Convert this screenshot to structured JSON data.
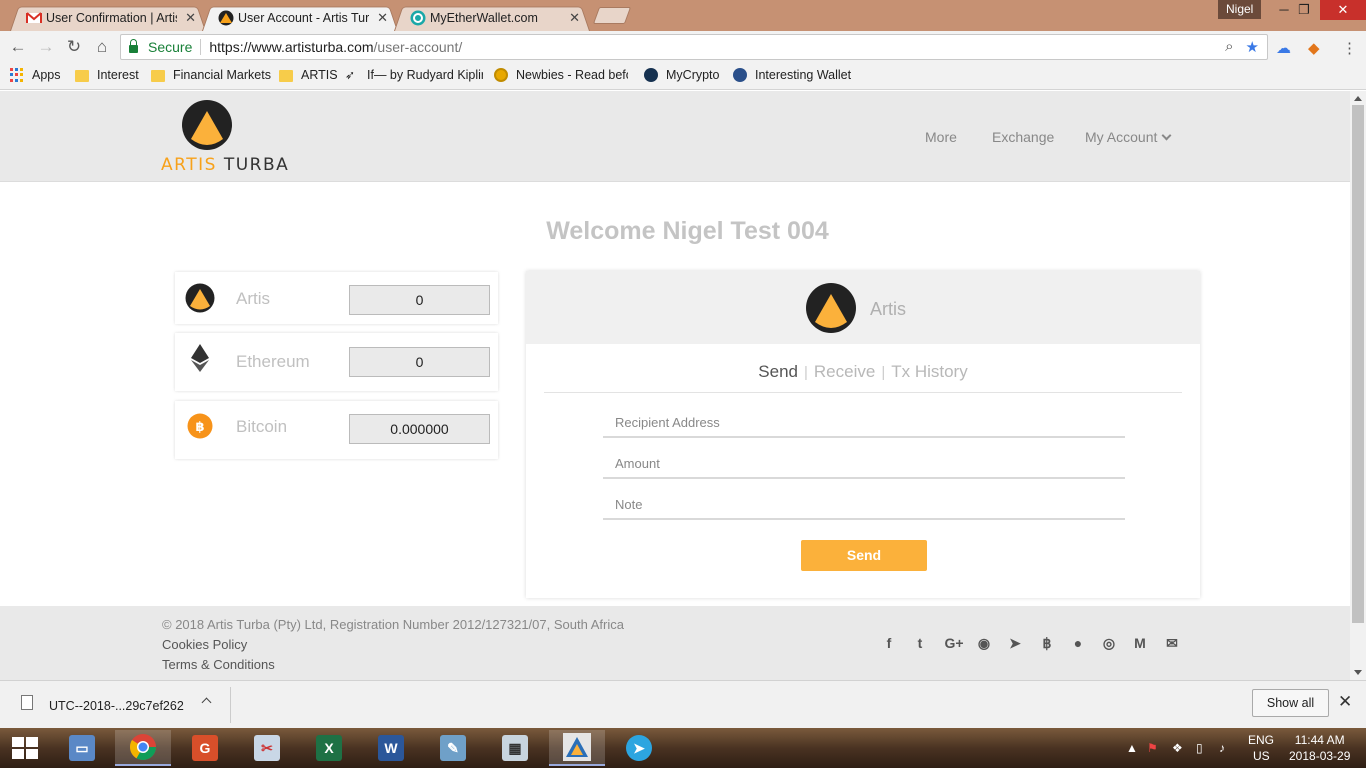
{
  "browser": {
    "tabs": [
      {
        "title": "User Confirmation | Artis",
        "icon": "gmail-icon"
      },
      {
        "title": "User Account - Artis Turb",
        "icon": "artis-icon"
      },
      {
        "title": "MyEtherWallet.com",
        "icon": "myetherwallet-icon"
      }
    ],
    "profile": "Nigel",
    "omnibox": {
      "secure_label": "Secure",
      "url_host": "https://www.artisturba.com",
      "url_path": "/user-account/"
    },
    "bookmarks": [
      {
        "label": "Apps",
        "icon": "apps-grid-icon"
      },
      {
        "label": "Interest",
        "icon": "folder-icon"
      },
      {
        "label": "Financial Markets",
        "icon": "folder-icon"
      },
      {
        "label": "ARTIS",
        "icon": "folder-icon"
      },
      {
        "label": "If— by Rudyard Kiplir",
        "icon": "bird-icon"
      },
      {
        "label": "Newbies - Read befo",
        "icon": "bitcoin-coin-icon"
      },
      {
        "label": "MyCrypto",
        "icon": "mycrypto-icon"
      },
      {
        "label": "Interesting Wallet",
        "icon": "globe-icon"
      }
    ]
  },
  "site": {
    "brand": {
      "part1": "ARTIS",
      "part2": "TURBA"
    },
    "nav": {
      "more": "More",
      "exchange": "Exchange",
      "my_account": "My Account"
    },
    "welcome": "Welcome Nigel Test 004",
    "balances": [
      {
        "name": "Artis",
        "value": "0",
        "icon": "artis-icon"
      },
      {
        "name": "Ethereum",
        "value": "0",
        "icon": "ethereum-icon"
      },
      {
        "name": "Bitcoin",
        "value": "0.000000",
        "icon": "bitcoin-icon"
      }
    ],
    "panel": {
      "title": "Artis",
      "tabs": {
        "send": "Send",
        "receive": "Receive",
        "history": "Tx History"
      },
      "fields": {
        "recipient": "Recipient Address",
        "amount": "Amount",
        "note": "Note"
      },
      "send_button": "Send"
    },
    "footer": {
      "copyright": "© 2018 Artis Turba (Pty) Ltd, Registration Number 2012/127321/07, South Africa",
      "cookies": "Cookies Policy",
      "terms": "Terms & Conditions",
      "social": [
        {
          "name": "facebook-icon",
          "glyph": "f"
        },
        {
          "name": "twitter-icon",
          "glyph": "t"
        },
        {
          "name": "google-plus-icon",
          "glyph": "G+"
        },
        {
          "name": "github-icon",
          "glyph": "◉"
        },
        {
          "name": "telegram-icon",
          "glyph": "➤"
        },
        {
          "name": "bitcoin-icon",
          "glyph": "฿"
        },
        {
          "name": "reddit-icon",
          "glyph": "●"
        },
        {
          "name": "instagram-icon",
          "glyph": "◎"
        },
        {
          "name": "medium-icon",
          "glyph": "M"
        },
        {
          "name": "email-icon",
          "glyph": "✉"
        }
      ]
    }
  },
  "downloads": {
    "file": "UTC--2018-...29c7ef262",
    "show_all": "Show all"
  },
  "taskbar": {
    "lang1": "ENG",
    "lang2": "US",
    "time": "11:44 AM",
    "date": "2018-03-29"
  },
  "colors": {
    "accent": "#fbb13b",
    "brand_orange": "#f7a11a",
    "secure_green": "#188038"
  }
}
